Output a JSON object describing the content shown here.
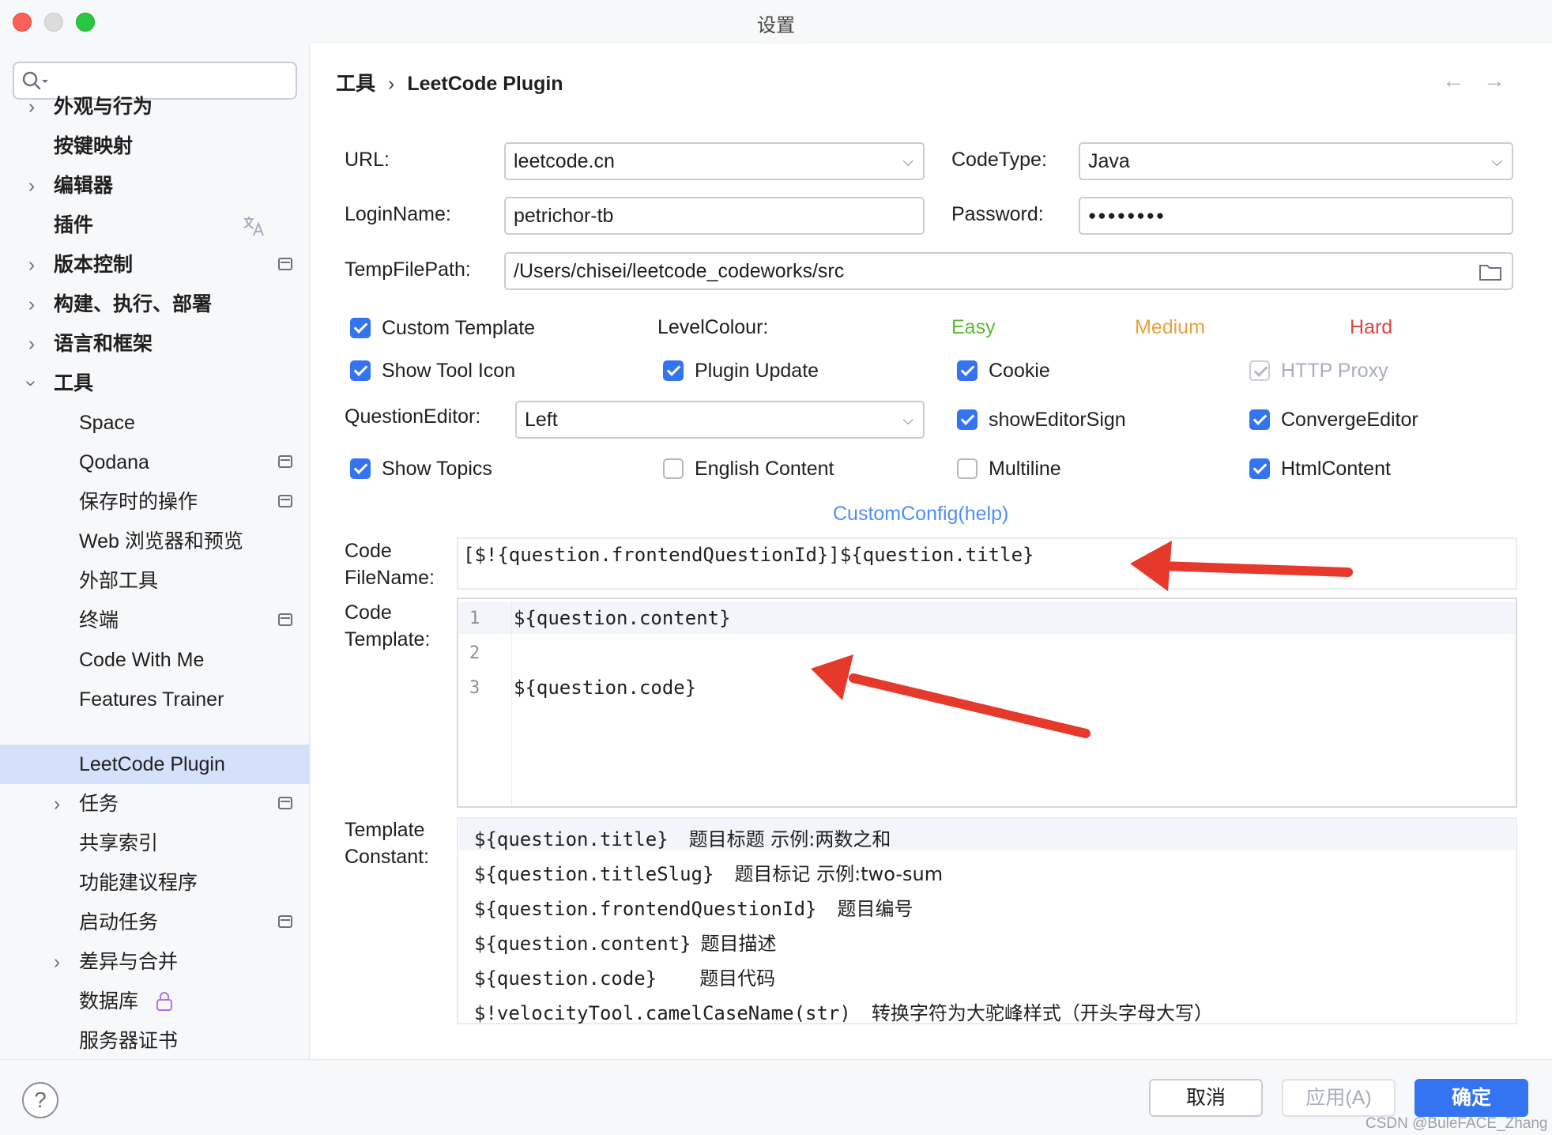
{
  "window": {
    "title": "设置"
  },
  "sidebar": {
    "items": [
      {
        "label": "外观与行为"
      },
      {
        "label": "按键映射"
      },
      {
        "label": "编辑器"
      },
      {
        "label": "插件"
      },
      {
        "label": "版本控制"
      },
      {
        "label": "构建、执行、部署"
      },
      {
        "label": "语言和框架"
      },
      {
        "label": "工具"
      },
      {
        "label": "Space"
      },
      {
        "label": "Qodana"
      },
      {
        "label": "保存时的操作"
      },
      {
        "label": "Web 浏览器和预览"
      },
      {
        "label": "外部工具"
      },
      {
        "label": "终端"
      },
      {
        "label": "Code With Me"
      },
      {
        "label": "Features Trainer"
      },
      {
        "label": "LeetCode Plugin"
      },
      {
        "label": "任务"
      },
      {
        "label": "共享索引"
      },
      {
        "label": "功能建议程序"
      },
      {
        "label": "启动任务"
      },
      {
        "label": "差异与合并"
      },
      {
        "label": "数据库"
      },
      {
        "label": "服务器证书"
      }
    ]
  },
  "breadcrumb": {
    "parent": "工具",
    "separator": "›",
    "current": "LeetCode Plugin"
  },
  "form": {
    "url_label": "URL:",
    "url_value": "leetcode.cn",
    "codetype_label": "CodeType:",
    "codetype_value": "Java",
    "loginname_label": "LoginName:",
    "loginname_value": "petrichor-tb",
    "password_label": "Password:",
    "password_value": "●●●●●●●●",
    "tempfilepath_label": "TempFilePath:",
    "tempfilepath_value": "/Users/chisei/leetcode_codeworks/src",
    "levelcolour_label": "LevelColour:",
    "level_easy": "Easy",
    "level_medium": "Medium",
    "level_hard": "Hard",
    "questioneditor_label": "QuestionEditor:",
    "questioneditor_value": "Left",
    "customconfig_link": "CustomConfig(help)",
    "code_filename_label_1": "Code",
    "code_filename_label_2": "FileName:",
    "code_filename_value": "[$!{question.frontendQuestionId}]${question.title}",
    "code_template_label_1": "Code",
    "code_template_label_2": "Template:",
    "template_constant_label_1": "Template",
    "template_constant_label_2": "Constant:"
  },
  "checkboxes": {
    "custom_template": {
      "label": "Custom Template",
      "checked": true
    },
    "show_tool_icon": {
      "label": "Show Tool Icon",
      "checked": true
    },
    "plugin_update": {
      "label": "Plugin Update",
      "checked": true
    },
    "cookie": {
      "label": "Cookie",
      "checked": true
    },
    "http_proxy": {
      "label": "HTTP Proxy",
      "checked": true,
      "disabled": true
    },
    "show_editor_sign": {
      "label": "showEditorSign",
      "checked": true
    },
    "converge_editor": {
      "label": "ConvergeEditor",
      "checked": true
    },
    "show_topics": {
      "label": "Show Topics",
      "checked": true
    },
    "english_content": {
      "label": "English Content",
      "checked": false
    },
    "multiline": {
      "label": "Multiline",
      "checked": false
    },
    "html_content": {
      "label": "HtmlContent",
      "checked": true
    }
  },
  "code_template": {
    "lines": [
      {
        "no": "1",
        "text": "${question.content}"
      },
      {
        "no": "2",
        "text": ""
      },
      {
        "no": "3",
        "text": "${question.code}"
      }
    ]
  },
  "template_constants": [
    {
      "name": "${question.title}",
      "desc": "题目标题  示例:两数之和"
    },
    {
      "name": "${question.titleSlug}",
      "desc": "题目标记  示例:two-sum"
    },
    {
      "name": "${question.frontendQuestionId}",
      "desc": "题目编号"
    },
    {
      "name": "${question.content}",
      "desc": "题目描述"
    },
    {
      "name": "${question.code}",
      "desc": "题目代码"
    },
    {
      "name": "$!velocityTool.camelCaseName(str)",
      "desc": "转换字符为大驼峰样式（开头字母大写）"
    }
  ],
  "footer": {
    "help_label": "?",
    "cancel_label": "取消",
    "apply_label": "应用(A)",
    "ok_label": "确定"
  },
  "watermark": "CSDN @BuleFACE_Zhang",
  "colors": {
    "accent": "#3574f0",
    "easy": "#5fb832",
    "medium": "#e9a23b",
    "hard": "#e0443e",
    "link": "#4f8ef7",
    "annotation_arrow": "#e53a2b",
    "selection": "#d5e1fa"
  }
}
